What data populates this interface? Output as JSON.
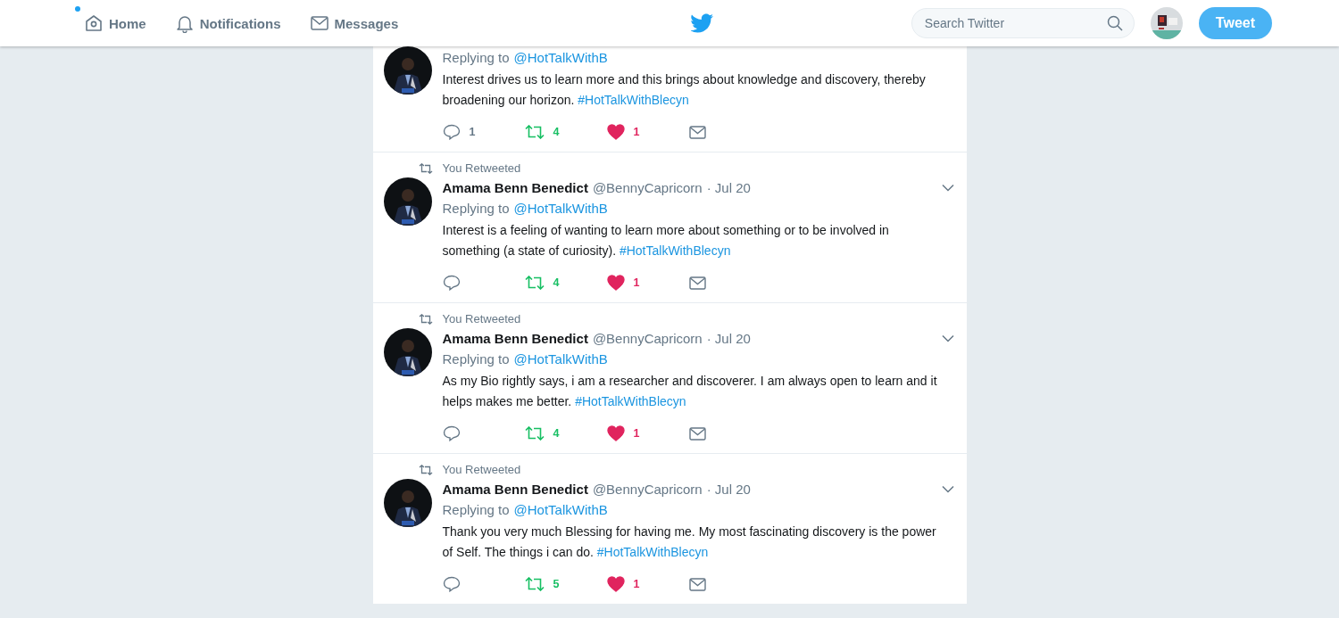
{
  "nav": {
    "items": [
      {
        "label": "Home",
        "kind": "home",
        "has_new": true
      },
      {
        "label": "Notifications",
        "kind": "bell",
        "has_new": false
      },
      {
        "label": "Messages",
        "kind": "mail",
        "has_new": false
      }
    ],
    "search": {
      "placeholder": "Search Twitter"
    },
    "tweet_button": "Tweet"
  },
  "tweets": [
    {
      "replying_label": "Replying to",
      "replying_to": "@HotTalkWithB",
      "text": "Interest drives us to learn more and this brings about knowledge and discovery, thereby broadening our horizon.",
      "hashtag": "#HotTalkWithBlecyn",
      "reply_count": "1",
      "retweet_count": "4",
      "like_count": "1",
      "retweeted": true,
      "liked": true
    },
    {
      "retweeted_label": "You Retweeted",
      "name": "Amama Benn Benedict",
      "handle": "@BennyCapricorn",
      "date": "· Jul 20",
      "replying_label": "Replying to",
      "replying_to": "@HotTalkWithB",
      "text": "Interest is a feeling of wanting to learn more about something or to be involved in something (a state of curiosity).",
      "hashtag": "#HotTalkWithBlecyn",
      "retweet_count": "4",
      "like_count": "1",
      "retweeted": true,
      "liked": true
    },
    {
      "retweeted_label": "You Retweeted",
      "name": "Amama Benn Benedict",
      "handle": "@BennyCapricorn",
      "date": "· Jul 20",
      "replying_label": "Replying to",
      "replying_to": "@HotTalkWithB",
      "text": "As my Bio rightly says, i am a researcher and discoverer. I am always open to learn and it helps  makes me better.",
      "hashtag": "#HotTalkWithBlecyn",
      "retweet_count": "4",
      "like_count": "1",
      "retweeted": true,
      "liked": true
    },
    {
      "retweeted_label": "You Retweeted",
      "name": "Amama Benn Benedict",
      "handle": "@BennyCapricorn",
      "date": "· Jul 20",
      "replying_label": "Replying to",
      "replying_to": "@HotTalkWithB",
      "text": "Thank you very much Blessing for having me. My most fascinating discovery is the power of Self. The things i can do.",
      "hashtag": "#HotTalkWithBlecyn",
      "retweet_count": "5",
      "like_count": "1",
      "retweeted": true,
      "liked": true
    }
  ]
}
